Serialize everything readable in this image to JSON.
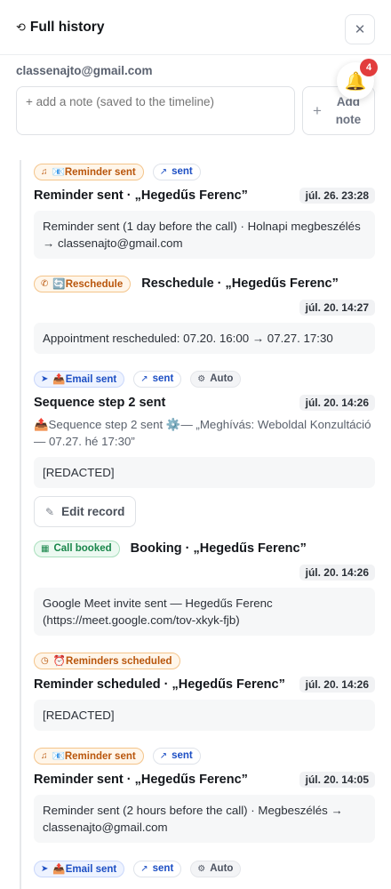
{
  "header": {
    "title": "Full history",
    "title_icon": "history-icon",
    "close_icon": "close-icon"
  },
  "contact": {
    "email": "classenajto@gmail.com"
  },
  "notifications": {
    "count": "4",
    "icon": "bell-icon"
  },
  "note": {
    "placeholder": "+ add a note (saved to the timeline)",
    "add_label": "Add note",
    "add_icon": "plus-icon"
  },
  "entries": [
    {
      "tags": [
        {
          "icon": "bell-outline-icon",
          "text": "📧Reminder sent"
        },
        {
          "icon": "arrow-up-right-icon",
          "text": "sent"
        }
      ],
      "title": "Reminder sent · „Hegedűs Ferenc”",
      "time": "júl. 26. 23:28",
      "body": "Reminder sent (1 day before the call) · Holnapi megbeszélés → classenajto@gmail.com"
    },
    {
      "tags": [
        {
          "icon": "phone-icon",
          "text": "🔄Reschedule"
        }
      ],
      "title": "Reschedule · „Hegedűs Ferenc”",
      "time": "júl. 20. 14:27",
      "body": "Appointment rescheduled: 07.20. 16:00 → 07.27. 17:30"
    },
    {
      "tags": [
        {
          "icon": "send-icon",
          "text": "📤Email sent"
        },
        {
          "icon": "arrow-up-right-icon",
          "text": "sent"
        },
        {
          "icon": "gear-icon",
          "text": "Auto"
        }
      ],
      "title": "Sequence step 2 sent",
      "time": "júl. 20. 14:26",
      "subtitle": "📤Sequence step 2 sent ⚙️— „Meghívás: Weboldal Konzultáció — 07.27. hé 17:30”",
      "body": "[REDACTED]",
      "edit_label": "Edit record"
    },
    {
      "tags": [
        {
          "icon": "calendar-icon",
          "text": "Call booked"
        }
      ],
      "title": "Booking · „Hegedűs Ferenc”",
      "time": "júl. 20. 14:26",
      "body": "Google Meet invite sent — Hegedűs Ferenc (https://meet.google.com/tov-xkyk-fjb)"
    },
    {
      "tags": [
        {
          "icon": "clock-icon",
          "text": "⏰Reminders scheduled"
        }
      ],
      "title": "Reminder scheduled · „Hegedűs Ferenc”",
      "time": "júl. 20. 14:26",
      "body": "[REDACTED]"
    },
    {
      "tags": [
        {
          "icon": "bell-outline-icon",
          "text": "📧Reminder sent"
        },
        {
          "icon": "arrow-up-right-icon",
          "text": "sent"
        }
      ],
      "title": "Reminder sent · „Hegedűs Ferenc”",
      "time": "júl. 20. 14:05",
      "body": "Reminder sent (2 hours before the call) · Megbeszélés → classenajto@gmail.com"
    },
    {
      "tags": [
        {
          "icon": "send-icon",
          "text": "📤Email sent"
        },
        {
          "icon": "arrow-up-right-icon",
          "text": "sent"
        },
        {
          "icon": "gear-icon",
          "text": "Auto"
        }
      ]
    }
  ]
}
